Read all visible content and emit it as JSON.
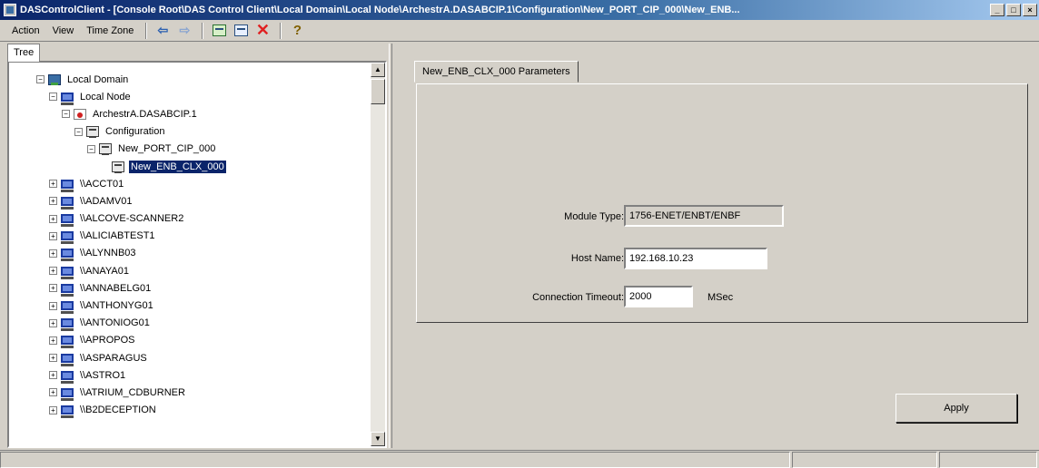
{
  "window": {
    "title": "DASControlClient - [Console Root\\DAS Control Client\\Local Domain\\Local Node\\ArchestrA.DASABCIP.1\\Configuration\\New_PORT_CIP_000\\New_ENB..."
  },
  "menubar": {
    "items": [
      "Action",
      "View",
      "Time Zone"
    ]
  },
  "toolbar": {
    "icons": [
      "back-arrow-icon",
      "forward-arrow-icon",
      "up-folder-icon",
      "show-hide-tree-icon",
      "delete-icon",
      "help-icon"
    ]
  },
  "tree": {
    "tab_label": "Tree",
    "nodes": [
      {
        "label": "Local Domain",
        "level": 0,
        "icon": "domain-icon",
        "expander": "−"
      },
      {
        "label": "Local Node",
        "level": 1,
        "icon": "computer-icon",
        "expander": "−"
      },
      {
        "label": "ArchestrA.DASABCIP.1",
        "level": 2,
        "icon": "archestra-icon",
        "expander": "−"
      },
      {
        "label": "Configuration",
        "level": 3,
        "icon": "config-icon",
        "expander": "−"
      },
      {
        "label": "New_PORT_CIP_000",
        "level": 4,
        "icon": "config-icon",
        "expander": "−"
      },
      {
        "label": "New_ENB_CLX_000",
        "level": 5,
        "icon": "config-icon",
        "expander": "",
        "selected": true
      },
      {
        "label": "\\\\ACCT01",
        "level": 1,
        "icon": "computer-icon",
        "expander": "+"
      },
      {
        "label": "\\\\ADAMV01",
        "level": 1,
        "icon": "computer-icon",
        "expander": "+"
      },
      {
        "label": "\\\\ALCOVE-SCANNER2",
        "level": 1,
        "icon": "computer-icon",
        "expander": "+"
      },
      {
        "label": "\\\\ALICIABTEST1",
        "level": 1,
        "icon": "computer-icon",
        "expander": "+"
      },
      {
        "label": "\\\\ALYNNB03",
        "level": 1,
        "icon": "computer-icon",
        "expander": "+"
      },
      {
        "label": "\\\\ANAYA01",
        "level": 1,
        "icon": "computer-icon",
        "expander": "+"
      },
      {
        "label": "\\\\ANNABELG01",
        "level": 1,
        "icon": "computer-icon",
        "expander": "+"
      },
      {
        "label": "\\\\ANTHONYG01",
        "level": 1,
        "icon": "computer-icon",
        "expander": "+"
      },
      {
        "label": "\\\\ANTONIOG01",
        "level": 1,
        "icon": "computer-icon",
        "expander": "+"
      },
      {
        "label": "\\\\APROPOS",
        "level": 1,
        "icon": "computer-icon",
        "expander": "+"
      },
      {
        "label": "\\\\ASPARAGUS",
        "level": 1,
        "icon": "computer-icon",
        "expander": "+"
      },
      {
        "label": "\\\\ASTRO1",
        "level": 1,
        "icon": "computer-icon",
        "expander": "+"
      },
      {
        "label": "\\\\ATRIUM_CDBURNER",
        "level": 1,
        "icon": "computer-icon",
        "expander": "+"
      },
      {
        "label": "\\\\B2DECEPTION",
        "level": 1,
        "icon": "computer-icon",
        "expander": "+"
      }
    ]
  },
  "params": {
    "tab_label": "New_ENB_CLX_000 Parameters",
    "module_type_label": "Module Type:",
    "module_type_value": "1756-ENET/ENBT/ENBF",
    "host_name_label": "Host Name:",
    "host_name_value": "192.168.10.23",
    "timeout_label": "Connection Timeout:",
    "timeout_value": "2000",
    "timeout_unit": "MSec",
    "apply_label": "Apply"
  }
}
